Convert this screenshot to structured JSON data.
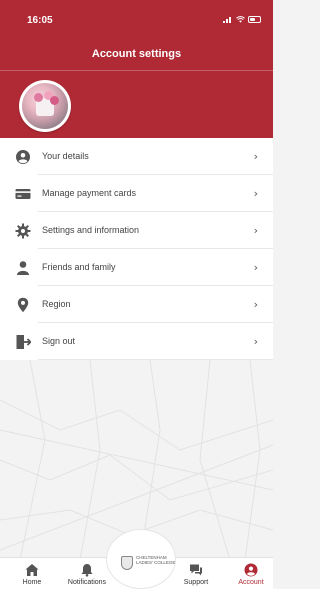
{
  "status_bar": {
    "time": "16:05"
  },
  "header": {
    "title": "Account settings"
  },
  "menu": [
    {
      "icon": "user-circle-icon",
      "label": "Your details"
    },
    {
      "icon": "credit-card-icon",
      "label": "Manage payment cards"
    },
    {
      "icon": "gear-icon",
      "label": "Settings and information"
    },
    {
      "icon": "person-icon",
      "label": "Friends and family"
    },
    {
      "icon": "location-pin-icon",
      "label": "Region"
    },
    {
      "icon": "sign-out-icon",
      "label": "Sign out"
    }
  ],
  "logo": {
    "text": "CHELTENHAM LADIES' COLLEGE"
  },
  "tabs": [
    {
      "icon": "home-icon",
      "label": "Home"
    },
    {
      "icon": "bell-icon",
      "label": "Notifications"
    },
    {
      "icon": "chat-icon",
      "label": "Support"
    },
    {
      "icon": "account-icon",
      "label": "Account"
    }
  ],
  "colors": {
    "brand": "#b02a35",
    "active_tab": "#b02a35"
  }
}
